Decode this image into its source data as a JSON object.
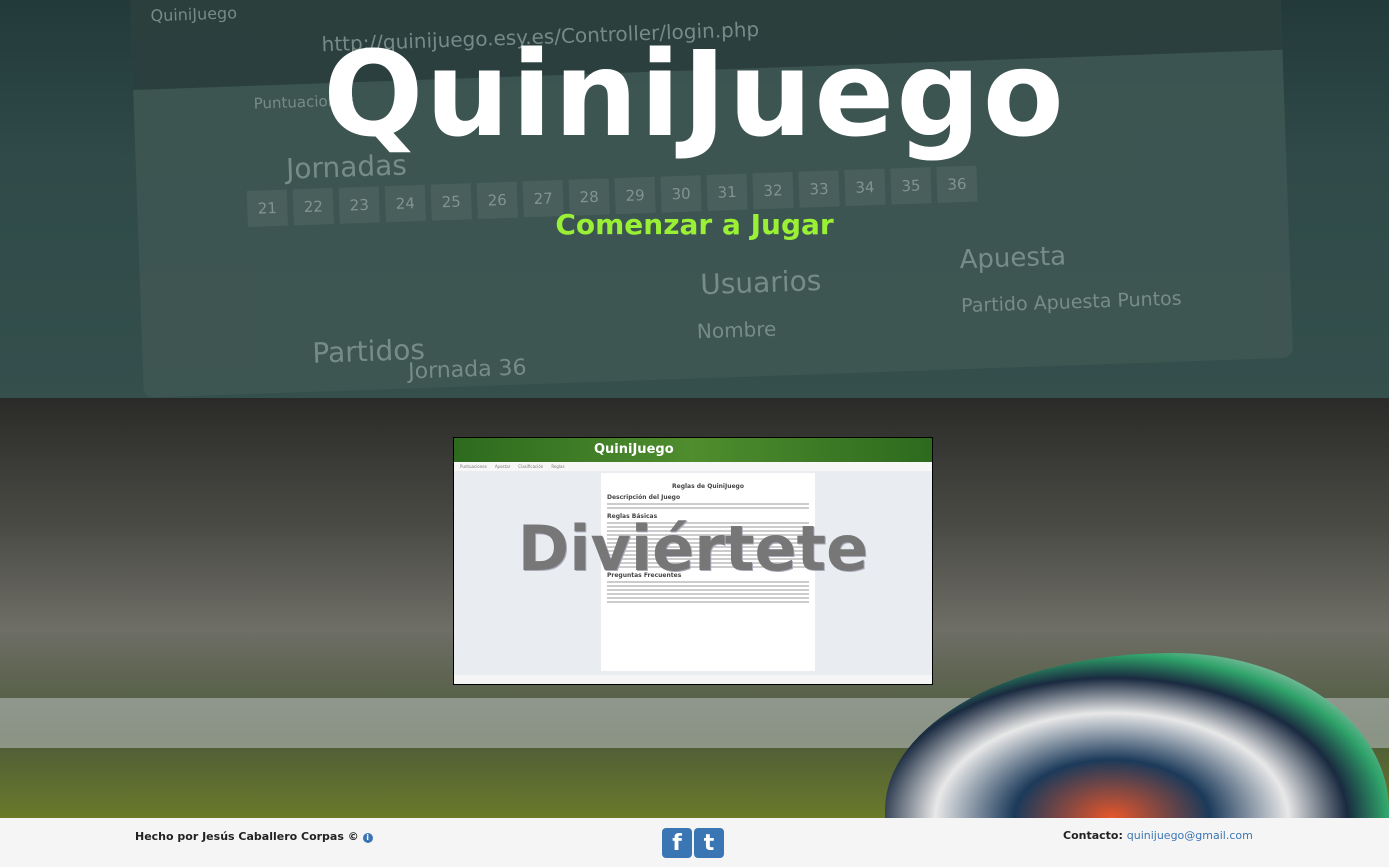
{
  "hero": {
    "title": "QuiniJuego",
    "start_label": "Comenzar a Jugar",
    "background": {
      "app_name": "QuiniJuego",
      "url": "http://quinijuego.esy.es/Controller/login.php",
      "tab": "Puntuaciones",
      "jornadas": "Jornadas",
      "numbers": [
        "21",
        "22",
        "23",
        "24",
        "25",
        "26",
        "27",
        "28",
        "29",
        "30",
        "31",
        "32",
        "33",
        "34",
        "35",
        "36"
      ],
      "usuarios": "Usuarios",
      "partidos": "Partidos",
      "apuesta": "Apuesta",
      "table_header": "Partido  Apuesta  Puntos",
      "nombre": "Nombre",
      "jornada": "Jornada 36"
    }
  },
  "preview": {
    "logo": "QuiniJuego",
    "tabs": [
      "Puntuaciones",
      "Apostar",
      "Clasificación",
      "Reglas"
    ],
    "heading": "Reglas de QuiniJuego",
    "sections": [
      "Descripción del Juego",
      "Reglas Básicas",
      "Preguntas Frecuentes"
    ],
    "overlay": "Diviértete"
  },
  "footer": {
    "credit": "Hecho por Jesús Caballero Corpas ©",
    "info_icon": "info-icon",
    "facebook": "f",
    "twitter": "t",
    "contact_label": "Contacto:",
    "email": "quinijuego@gmail.com",
    "link_color": "#3a76b4"
  },
  "colors": {
    "accent": "#9af035"
  }
}
